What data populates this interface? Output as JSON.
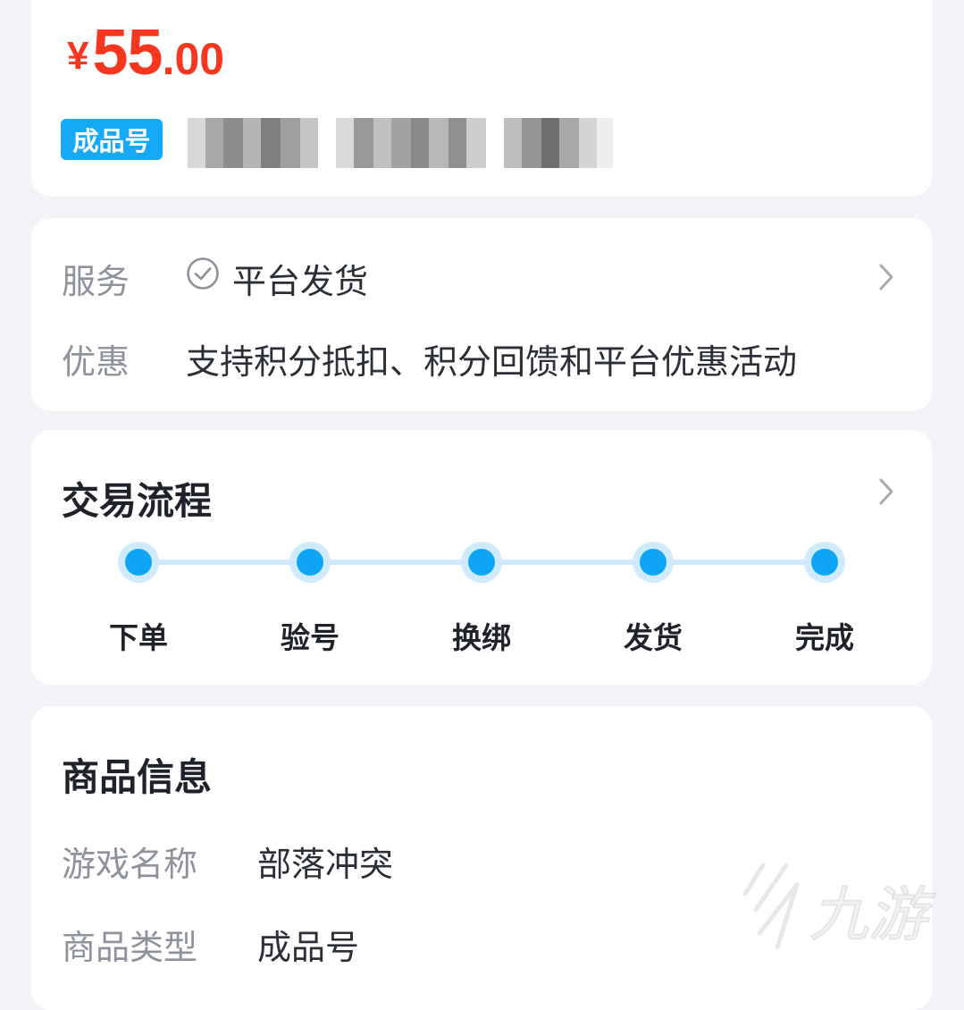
{
  "price": {
    "currency": "¥",
    "integer": "55",
    "decimal": ".00"
  },
  "account": {
    "type_badge": "成品号"
  },
  "service": {
    "label": "服务",
    "value": "平台发货",
    "discount_label": "优惠",
    "discount_value": "支持积分抵扣、积分回馈和平台优惠活动"
  },
  "process": {
    "title": "交易流程",
    "steps": [
      "下单",
      "验号",
      "换绑",
      "发货",
      "完成"
    ]
  },
  "goods": {
    "title": "商品信息",
    "game_name_label": "游戏名称",
    "game_name_value": "部落冲突",
    "type_label": "商品类型",
    "type_value": "成品号"
  },
  "watermark": {
    "brand": "九游"
  },
  "colors": {
    "price": "#f5371f",
    "accent": "#15aaf7",
    "step_dot": "#0ea5f6",
    "background": "#f3f4f8"
  }
}
